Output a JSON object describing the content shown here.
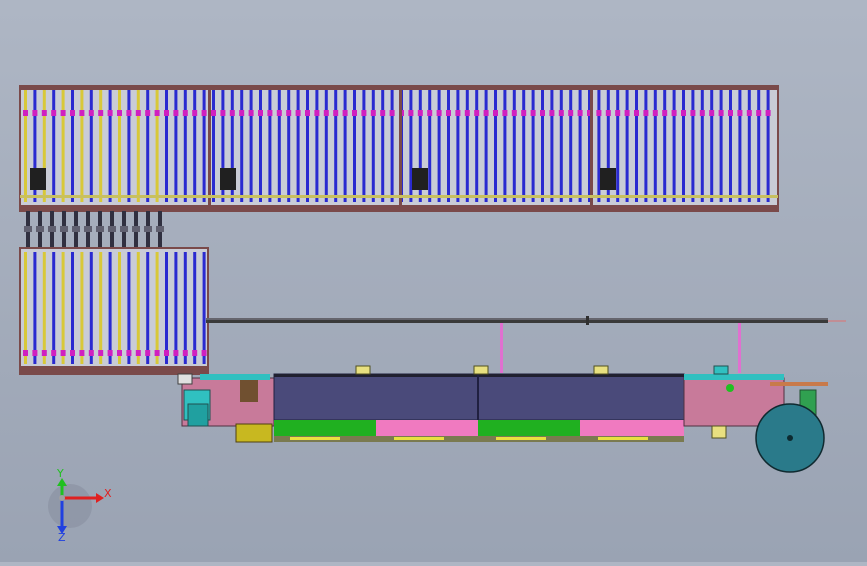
{
  "triad": {
    "x_label": "X",
    "y_label": "Y",
    "z_label": "Z",
    "x_color": "#e02020",
    "y_color": "#20c020",
    "z_color": "#2040e0"
  },
  "colors": {
    "frame": "#7a4a4a",
    "roller": "#2a2ad0",
    "roller_highlight": "#d8c838",
    "accent": "#d020c0",
    "body_pink": "#c87a9a",
    "belt_dark": "#4a4a7a",
    "green_band": "#20b020",
    "pink_band": "#f07ac0",
    "cyan": "#30c0c0",
    "olive": "#c8b820",
    "wheel": "#2a7a8a"
  }
}
